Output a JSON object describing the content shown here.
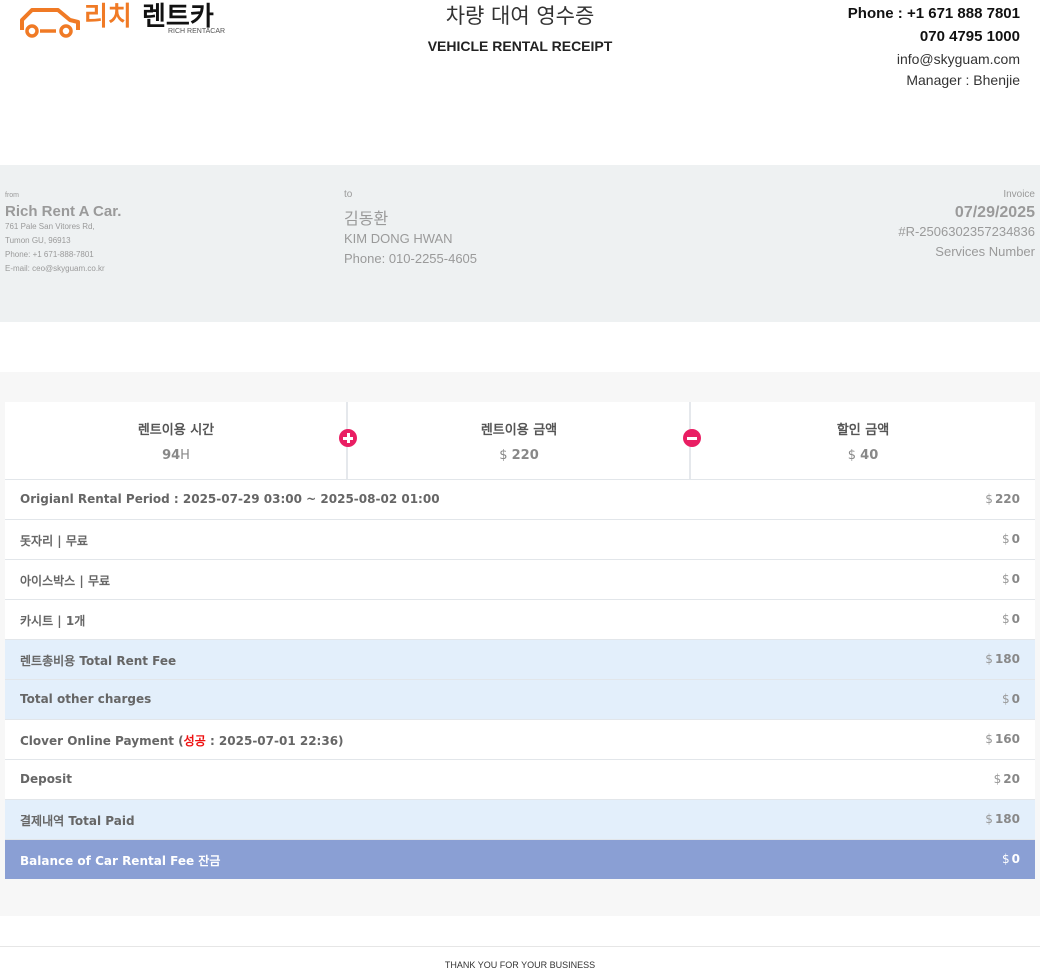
{
  "logo": {
    "text_ko": "리치렌트카",
    "text_en": "RICH RENTACAR"
  },
  "header": {
    "title_ko": "차량 대여 영수증",
    "title_en": "VEHICLE RENTAL RECEIPT",
    "phone1": "Phone : +1 671 888 7801",
    "phone2": "070 4795 1000",
    "email": "info@skyguam.com",
    "manager": "Manager : Bhenjie"
  },
  "from": {
    "label": "from",
    "name": "Rich Rent A Car.",
    "address1": "761 Pale San Vitores Rd,",
    "address2": "Tumon GU, 96913",
    "phone": "Phone: +1 671-888-7801",
    "email": "E-mail: ceo@skyguam.co.kr"
  },
  "to": {
    "label": "to",
    "name_ko": "김동환",
    "name_en": "KIM DONG HWAN",
    "phone": "Phone: 010-2255-4605"
  },
  "invoice": {
    "label": "Invoice",
    "date": "07/29/2025",
    "number": "#R-2506302357234836",
    "services_label": "Services Number"
  },
  "summary": {
    "rent_time_label": "렌트이용 시간",
    "rent_time_value": "94",
    "rent_time_unit": "H",
    "rent_amount_label": "렌트이용 금액",
    "rent_amount_cur": "$",
    "rent_amount_value": "220",
    "discount_label": "할인 금액",
    "discount_cur": "$",
    "discount_value": "40"
  },
  "rows": [
    {
      "label": "Origianl Rental Period : 2025-07-29 03:00 ~ 2025-08-02 01:00",
      "cur": "$",
      "amount": "220"
    },
    {
      "label": "돗자리 | 무료",
      "cur": "$",
      "amount": "0"
    },
    {
      "label": "아이스박스 | 무료",
      "cur": "$",
      "amount": "0"
    },
    {
      "label": "카시트 | 1개",
      "cur": "$",
      "amount": "0"
    },
    {
      "label": "렌트총비용 Total Rent Fee",
      "cur": "$",
      "amount": "180"
    },
    {
      "label": "Total other charges",
      "cur": "$",
      "amount": "0"
    },
    {
      "label_pre": "Clover Online Payment (",
      "label_status": "성공",
      "label_post": " : 2025-07-01 22:36)",
      "cur": "$",
      "amount": "160"
    },
    {
      "label": "Deposit",
      "cur": "$",
      "amount": "20"
    },
    {
      "label": "결제내역 Total Paid",
      "cur": "$",
      "amount": "180"
    },
    {
      "label": "Balance of Car Rental Fee 잔금",
      "cur": "$",
      "amount": "0"
    }
  ],
  "footer": {
    "thanks": "THANK YOU FOR YOUR BUSINESS"
  },
  "colors": {
    "brand_orange": "#f07a25",
    "accent_pink": "#e91e63",
    "balance_row": "#8a9fd4",
    "highlight_row": "#e3effb",
    "status_red": "#e11111"
  }
}
